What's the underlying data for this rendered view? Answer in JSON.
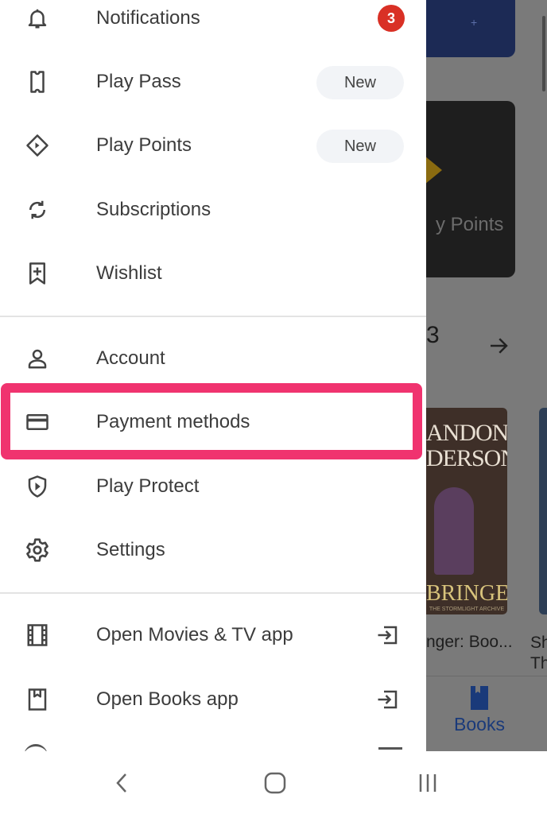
{
  "drawer": {
    "items": [
      {
        "label": "Notifications",
        "icon": "bell-icon",
        "badge": "3"
      },
      {
        "label": "Play Pass",
        "icon": "ticket-icon",
        "chip": "New"
      },
      {
        "label": "Play Points",
        "icon": "diamond-icon",
        "chip": "New"
      },
      {
        "label": "Subscriptions",
        "icon": "sync-icon"
      },
      {
        "label": "Wishlist",
        "icon": "bookmark-add-icon"
      },
      {
        "label": "Account",
        "icon": "person-icon"
      },
      {
        "label": "Payment methods",
        "icon": "credit-card-icon",
        "highlighted": true
      },
      {
        "label": "Play Protect",
        "icon": "shield-play-icon"
      },
      {
        "label": "Settings",
        "icon": "gear-icon"
      },
      {
        "label": "Open Movies & TV app",
        "icon": "film-icon",
        "trailing_icon": "open-app-icon"
      },
      {
        "label": "Open Books app",
        "icon": "book-icon",
        "trailing_icon": "open-app-icon"
      }
    ],
    "highlight_color": "#f0336f"
  },
  "background_app": {
    "points_tile_text": "y Points",
    "section_heading": "3",
    "book_cover_author": "ANDON DERSON",
    "book_cover_title": "BRINGER",
    "book_cover_subtitle": "THE STORMLIGHT ARCHIVE",
    "book_title": "nger: Boo...",
    "book_title_2_line1": "Sh",
    "book_title_2_line2": "Th",
    "bottom_tab_label": "Books"
  },
  "system_nav": {
    "buttons": [
      "back-icon",
      "home-icon",
      "recents-icon"
    ]
  }
}
